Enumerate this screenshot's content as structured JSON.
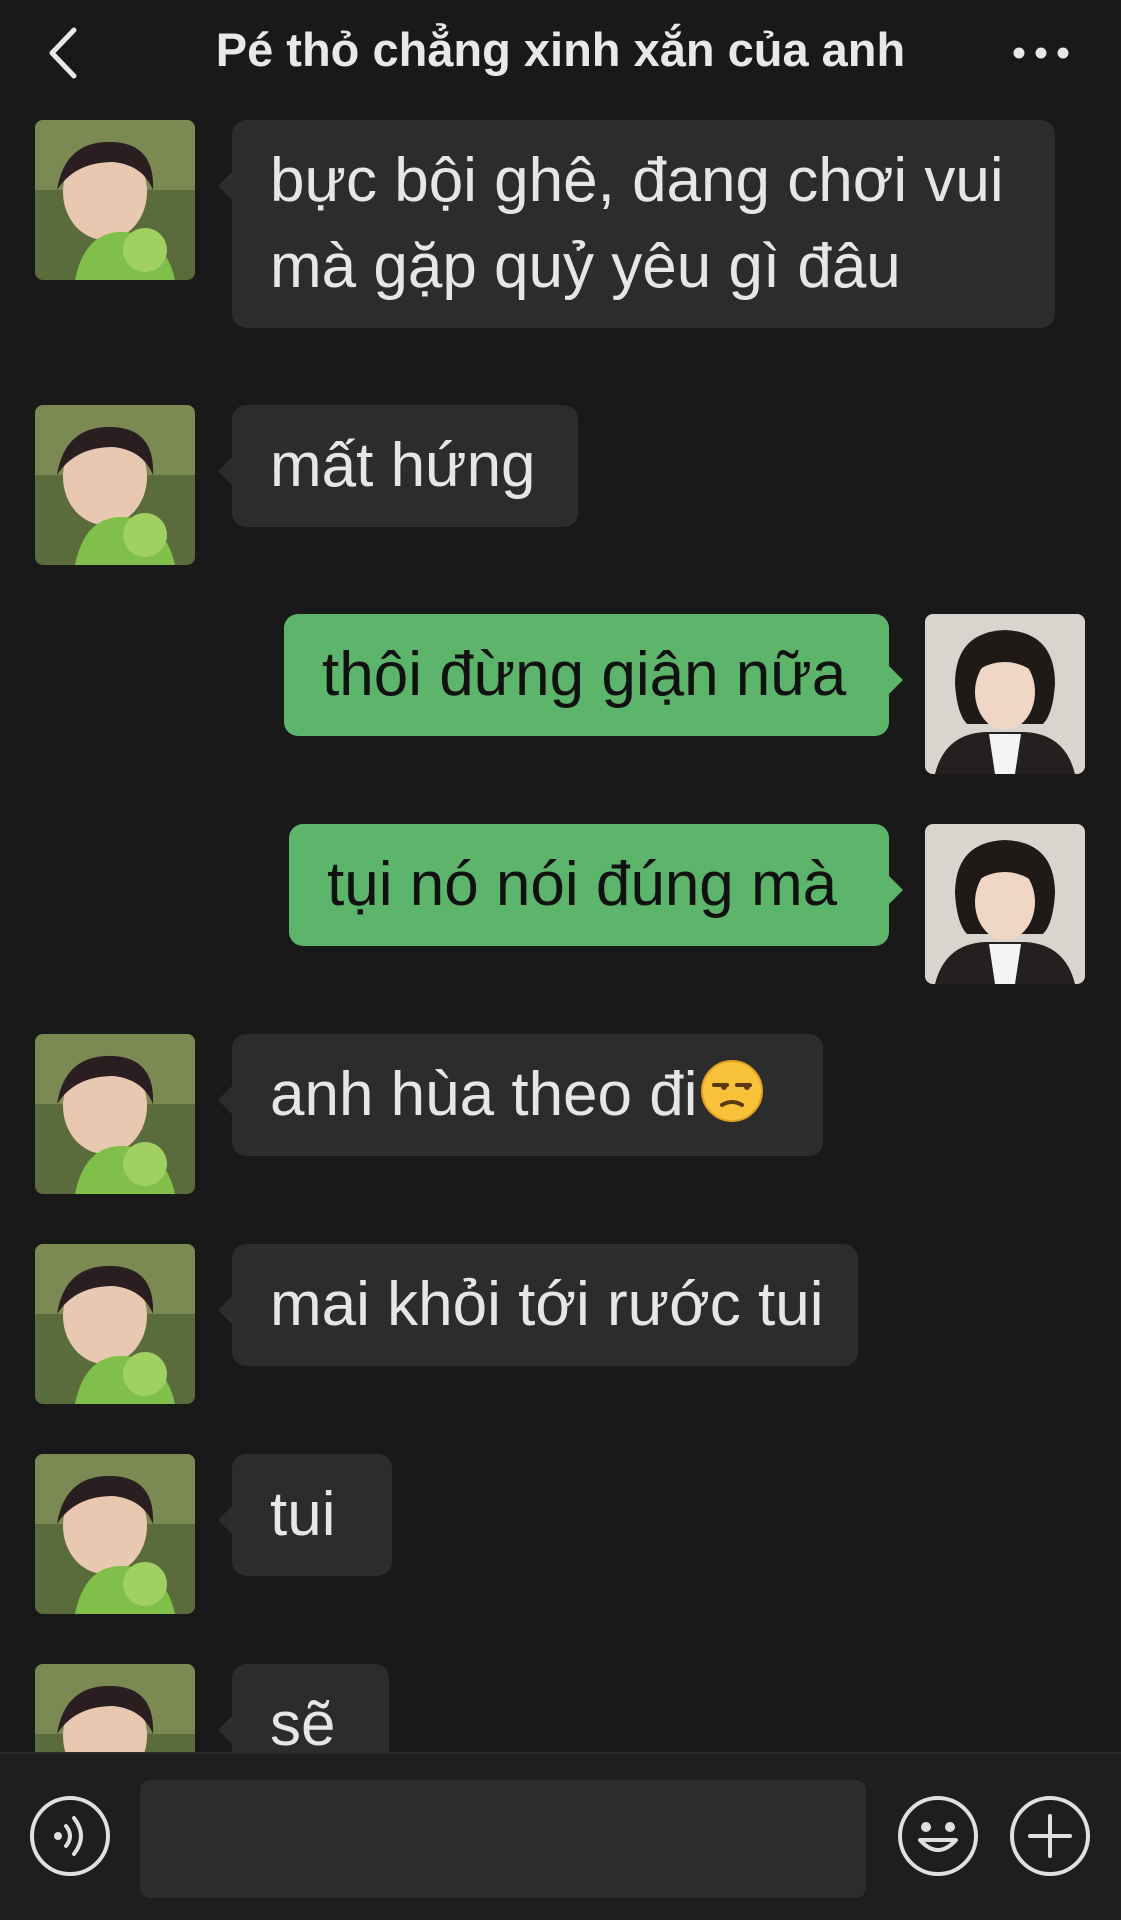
{
  "header": {
    "title": "Pé thỏ chẳng xinh xắn của anh",
    "back_icon": "chevron-left-icon",
    "more_icon": "more-dots-icon"
  },
  "messages": [
    {
      "side": "left",
      "lines": [
        "bực bội ghê, đang chơi vui",
        "mà gặp quỷ yêu gì đâu"
      ]
    },
    {
      "side": "left",
      "text": "mất hứng"
    },
    {
      "side": "right",
      "text": "thôi đừng giận nữa"
    },
    {
      "side": "right",
      "text": "tụi nó nói đúng mà"
    },
    {
      "side": "left",
      "text": "anh hùa theo đi",
      "emoji": "unamused-face-emoji"
    },
    {
      "side": "left",
      "text": "mai khỏi tới rước tui"
    },
    {
      "side": "left",
      "text": "tui"
    },
    {
      "side": "left",
      "text": "sẽ"
    }
  ],
  "input_bar": {
    "placeholder": "",
    "voice_icon": "voice-icon",
    "emoji_icon": "emoji-icon",
    "plus_icon": "plus-icon"
  },
  "colors": {
    "background": "#191919",
    "incoming_bubble": "#2c2c2c",
    "outgoing_bubble": "#5cb56b",
    "text_light": "#e6e6e6",
    "text_dark": "#111111"
  }
}
